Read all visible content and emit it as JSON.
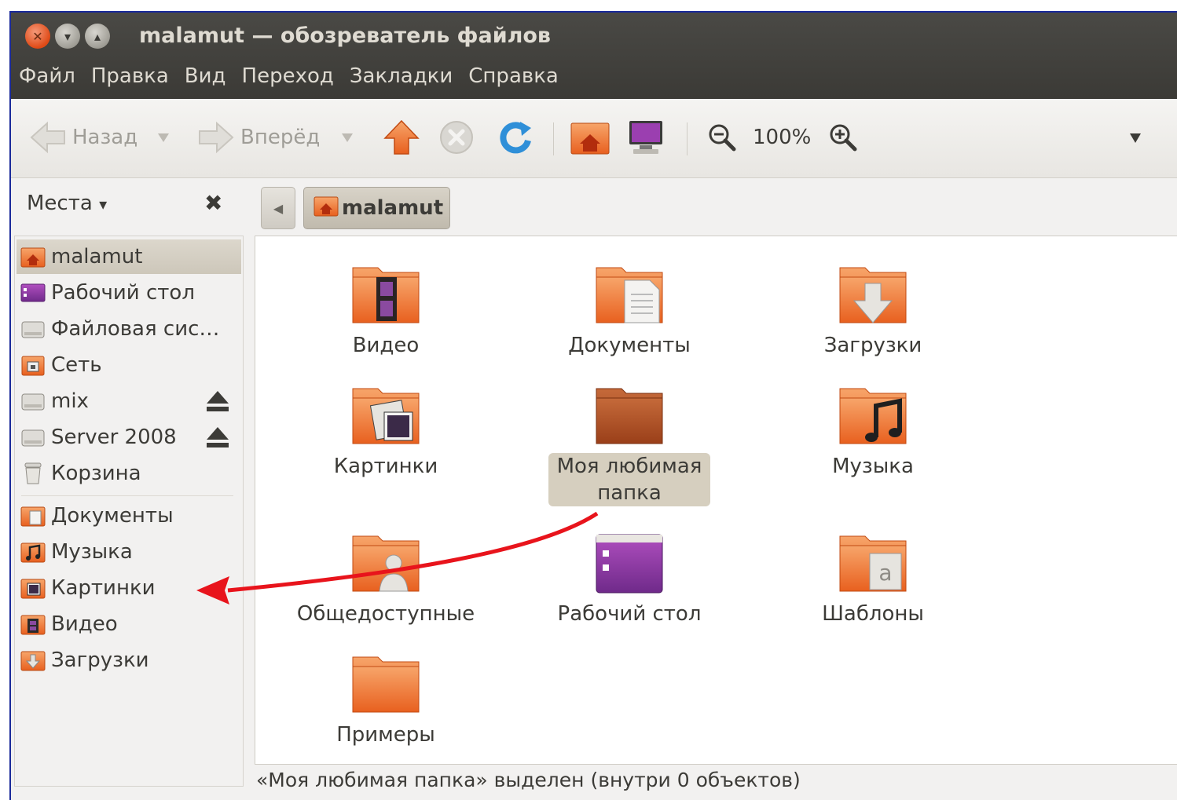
{
  "window": {
    "title": "malamut — обозреватель файлов"
  },
  "menubar": [
    "Файл",
    "Правка",
    "Вид",
    "Переход",
    "Закладки",
    "Справка"
  ],
  "toolbar": {
    "back_label": "Назад",
    "forward_label": "Вперёд",
    "zoom_level": "100%"
  },
  "places": {
    "label": "Места",
    "items": [
      {
        "label": "malamut",
        "icon": "home-folder-icon",
        "selected": true
      },
      {
        "label": "Рабочий стол",
        "icon": "desktop-icon"
      },
      {
        "label": "Файловая сис…",
        "icon": "drive-icon"
      },
      {
        "label": "Сеть",
        "icon": "network-icon"
      },
      {
        "label": "mix",
        "icon": "drive-icon",
        "eject": true
      },
      {
        "label": "Server 2008",
        "icon": "drive-icon",
        "eject": true
      },
      {
        "label": "Корзина",
        "icon": "trash-icon"
      },
      {
        "label": "Документы",
        "icon": "documents-folder-icon"
      },
      {
        "label": "Музыка",
        "icon": "music-folder-icon"
      },
      {
        "label": "Картинки",
        "icon": "pictures-folder-icon"
      },
      {
        "label": "Видео",
        "icon": "video-folder-icon"
      },
      {
        "label": "Загрузки",
        "icon": "downloads-folder-icon"
      }
    ]
  },
  "location": {
    "current": "malamut"
  },
  "files": [
    {
      "label": "Видео",
      "icon": "video-folder-icon"
    },
    {
      "label": "Документы",
      "icon": "documents-folder-icon"
    },
    {
      "label": "Загрузки",
      "icon": "downloads-folder-icon"
    },
    {
      "label": "Картинки",
      "icon": "pictures-folder-icon"
    },
    {
      "label": "Моя любимая папка",
      "icon": "folder-icon",
      "selected": true
    },
    {
      "label": "Музыка",
      "icon": "music-folder-icon"
    },
    {
      "label": "Общедоступные",
      "icon": "public-folder-icon"
    },
    {
      "label": "Рабочий стол",
      "icon": "desktop-folder-icon"
    },
    {
      "label": "Шаблоны",
      "icon": "templates-folder-icon"
    },
    {
      "label": "Примеры",
      "icon": "folder-icon"
    }
  ],
  "status": {
    "text": "«Моя любимая папка» выделен (внутри 0 объектов)"
  },
  "colors": {
    "titlebar": "#3c3b37",
    "folder_orange": "#e8601f",
    "annotation_arrow": "#e8141c"
  }
}
